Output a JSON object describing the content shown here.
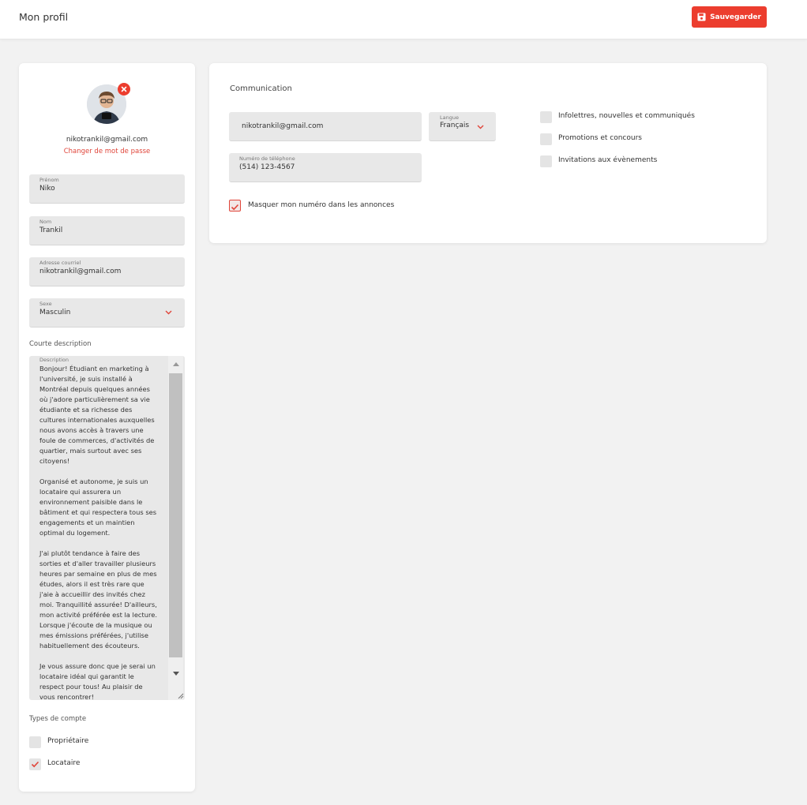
{
  "header": {
    "title": "Mon profil",
    "save_label": "Sauvegarder",
    "accent": "#ec3d2e"
  },
  "profile": {
    "email": "nikotrankil@gmail.com",
    "change_password": "Changer de mot de passe",
    "fields": {
      "first_name": {
        "label": "Prénom",
        "value": "Niko"
      },
      "last_name": {
        "label": "Nom",
        "value": "Trankil"
      },
      "email": {
        "label": "Adresse courriel",
        "value": "nikotrankil@gmail.com"
      },
      "gender": {
        "label": "Sexe",
        "value": "Masculin"
      }
    },
    "short_description_label": "Courte description",
    "description": {
      "label": "Description",
      "paragraphs": [
        "Bonjour! Étudiant en marketing à l'université, je suis installé à Montréal depuis quelques années où j'adore particulièrement sa vie étudiante et sa richesse des cultures internationales auxquelles nous avons accès à travers une foule de commerces, d'activités de quartier, mais surtout avec ses citoyens!",
        "Organisé et autonome, je suis un locataire qui assurera un environnement paisible dans le bâtiment et qui respectera tous ses engagements et un maintien optimal du logement.",
        "J'ai plutôt tendance à faire des sorties et d'aller travailler plusieurs heures par semaine en plus de mes études, alors il est très rare que j'aie à accueillir des invités chez moi. Tranquillité assurée! D'ailleurs, mon activité préférée est la lecture. Lorsque j'écoute de la musique ou mes émissions préférées, j'utilise habituellement des écouteurs.",
        "Je vous assure donc que je serai un locataire idéal qui garantit le respect pour tous! Au plaisir de vous rencontrer!"
      ]
    },
    "account_types": {
      "label": "Types de compte",
      "options": [
        {
          "label": "Propriétaire",
          "checked": false
        },
        {
          "label": "Locataire",
          "checked": true
        }
      ]
    }
  },
  "communication": {
    "title": "Communication",
    "email_value": "nikotrankil@gmail.com",
    "language": {
      "label": "Langue",
      "value": "Français"
    },
    "phone": {
      "label": "Numéro de téléphone",
      "value": "(514) 123-4567"
    },
    "hide_number": {
      "label": "Masquer mon numéro dans les annonces",
      "checked": true
    },
    "subscriptions": [
      {
        "label": "Infolettres, nouvelles et communiqués",
        "checked": false
      },
      {
        "label": "Promotions et concours",
        "checked": false
      },
      {
        "label": "Invitations aux évènements",
        "checked": false
      }
    ]
  }
}
